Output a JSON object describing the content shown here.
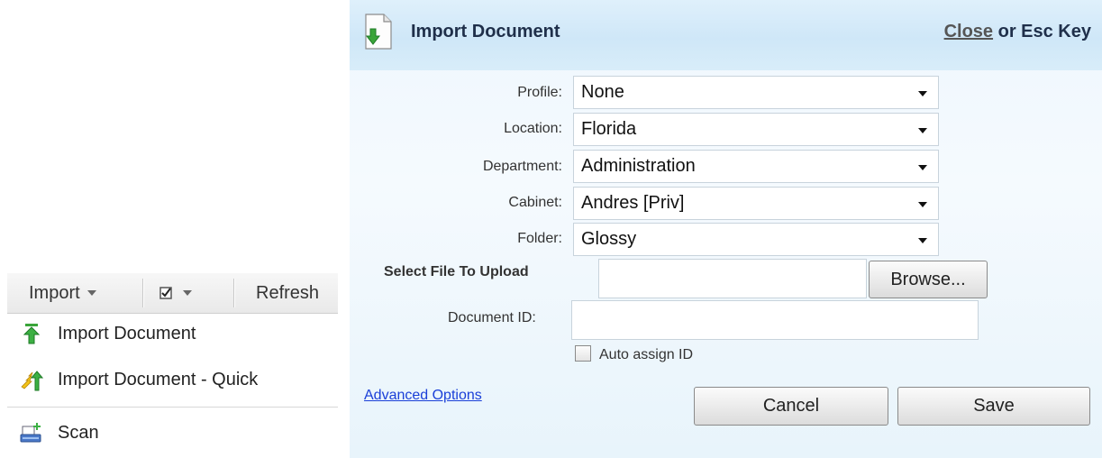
{
  "toolbar": {
    "import_label": "Import",
    "refresh_label": "Refresh"
  },
  "menu": {
    "items": [
      {
        "label": "Import Document",
        "icon": "green-up-arrow-icon"
      },
      {
        "label": "Import Document - Quick",
        "icon": "lightning-arrow-icon"
      },
      {
        "label": "Scan",
        "icon": "scanner-icon"
      }
    ]
  },
  "dialog": {
    "title": "Import Document",
    "close_link": "Close",
    "close_suffix": " or Esc Key",
    "fields": {
      "profile_label": "Profile:",
      "profile_value": "None",
      "location_label": "Location:",
      "location_value": "Florida",
      "department_label": "Department:",
      "department_value": "Administration",
      "cabinet_label": "Cabinet:",
      "cabinet_value": "Andres [Priv]",
      "folder_label": "Folder:",
      "folder_value": "Glossy",
      "upload_label": "Select File To Upload",
      "browse_label": "Browse...",
      "document_id_label": "Document ID:",
      "document_id_value": "",
      "auto_assign_label": "Auto assign ID"
    },
    "advanced_link": "Advanced Options",
    "cancel_label": "Cancel",
    "save_label": "Save"
  }
}
